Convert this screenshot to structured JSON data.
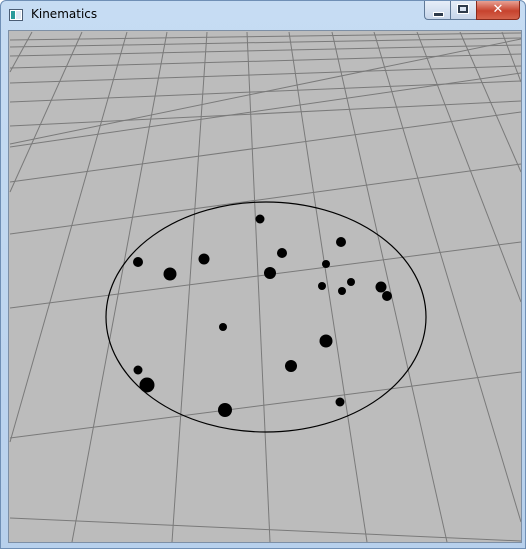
{
  "window": {
    "title": "Kinematics",
    "frame_color": "#b7d0ec",
    "icon": "app-window-icon"
  },
  "controls": {
    "minimize": {
      "icon": "minimize-icon"
    },
    "maximize": {
      "icon": "maximize-icon"
    },
    "close": {
      "icon": "close-icon",
      "glyph": "✕",
      "color": "#c7432e"
    }
  },
  "scene": {
    "background": "#bcbcbc",
    "grid_color": "#7a7a7a",
    "circle_color": "#000000",
    "ball_color": "#000000",
    "ball_count": 20
  }
}
